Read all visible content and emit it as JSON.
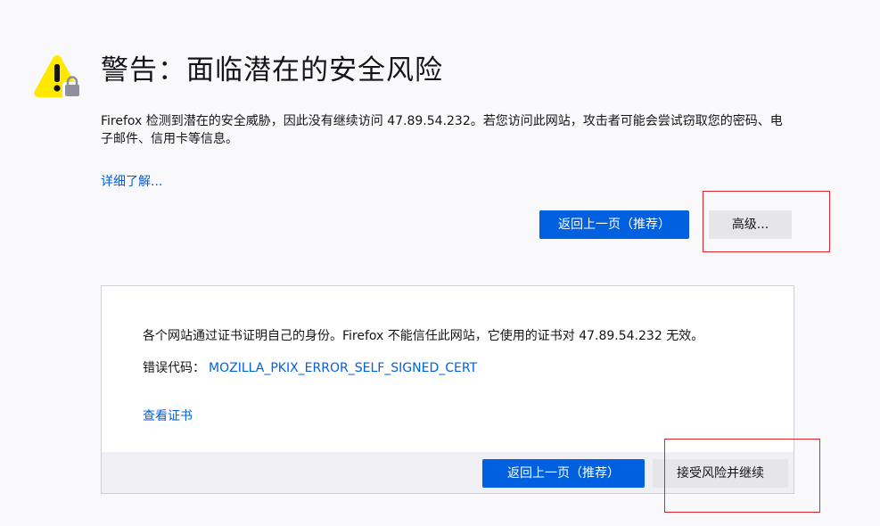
{
  "icons": {
    "warning": "warning-lock-icon",
    "warning_color": "#ffe900",
    "lock_color": "#8f8f9d"
  },
  "title": "警告：面临潜在的安全风险",
  "description": "Firefox 检测到潜在的安全威胁，因此没有继续访问 47.89.54.232。若您访问此网站，攻击者可能会尝试窃取您的密码、电子邮件、信用卡等信息。",
  "learn_more": "详细了解...",
  "actions": {
    "go_back": "返回上一页（推荐）",
    "advanced": "高级..."
  },
  "advanced_panel": {
    "text": "各个网站通过证书证明自己的身份。Firefox 不能信任此网站，它使用的证书对 47.89.54.232 无效。",
    "error_label": "错误代码：",
    "error_code": "MOZILLA_PKIX_ERROR_SELF_SIGNED_CERT",
    "view_certificate": "查看证书",
    "go_back": "返回上一页（推荐）",
    "accept": "接受风险并继续"
  },
  "colors": {
    "accent": "#0060df",
    "link": "#0061e0",
    "highlight_border": "#e0242b"
  }
}
